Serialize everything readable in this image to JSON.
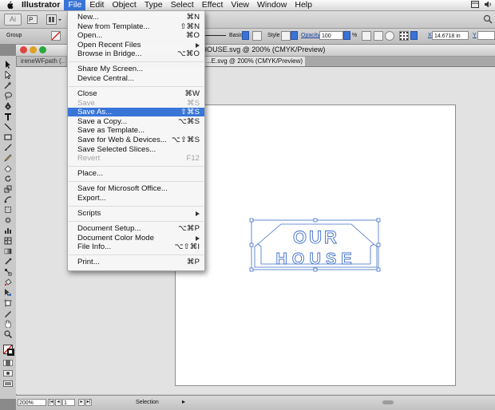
{
  "menubar": {
    "items": [
      {
        "label": "Illustrator"
      },
      {
        "label": "File"
      },
      {
        "label": "Edit"
      },
      {
        "label": "Object"
      },
      {
        "label": "Type"
      },
      {
        "label": "Select"
      },
      {
        "label": "Effect"
      },
      {
        "label": "View"
      },
      {
        "label": "Window"
      },
      {
        "label": "Help"
      }
    ],
    "active_index": 1,
    "highlight_color": "#3875d7"
  },
  "control_bar": {
    "selection_type": "Group",
    "stroke_style": "Basic",
    "style_label": "Style",
    "opacity_label": "Opacity",
    "opacity_value": "100",
    "opacity_unit": "%",
    "x_label": "X",
    "x_value": "14.6718 in",
    "y_label": "Y"
  },
  "document": {
    "window_title": "OURHOUSE.svg @ 200% (CMYK/Preview)",
    "tabs": [
      {
        "label": "ireneWFpath (..."
      },
      {
        "label": "...E.svg @ 200% (CMYK/Preview)"
      }
    ],
    "artwork": {
      "word1": "OUR",
      "word2": "HOUSE"
    }
  },
  "status_bar": {
    "zoom": "200%",
    "page": "1",
    "mode": "Selection"
  },
  "file_menu": {
    "items": [
      {
        "label": "New...",
        "shortcut": "⌘N"
      },
      {
        "label": "New from Template...",
        "shortcut": "⇧⌘N"
      },
      {
        "label": "Open...",
        "shortcut": "⌘O"
      },
      {
        "label": "Open Recent Files",
        "shortcut": ""
      },
      {
        "label": "Browse in Bridge...",
        "shortcut": "⌥⌘O"
      },
      {
        "label": "Share My Screen...",
        "shortcut": ""
      },
      {
        "label": "Device Central...",
        "shortcut": ""
      },
      {
        "label": "Close",
        "shortcut": "⌘W"
      },
      {
        "label": "Save",
        "shortcut": "⌘S"
      },
      {
        "label": "Save As...",
        "shortcut": "⇧⌘S"
      },
      {
        "label": "Save a Copy...",
        "shortcut": "⌥⌘S"
      },
      {
        "label": "Save as Template...",
        "shortcut": ""
      },
      {
        "label": "Save for Web & Devices...",
        "shortcut": "⌥⇧⌘S"
      },
      {
        "label": "Save Selected Slices...",
        "shortcut": ""
      },
      {
        "label": "Revert",
        "shortcut": "F12"
      },
      {
        "label": "Place...",
        "shortcut": ""
      },
      {
        "label": "Save for Microsoft Office...",
        "shortcut": ""
      },
      {
        "label": "Export...",
        "shortcut": ""
      },
      {
        "label": "Scripts",
        "shortcut": ""
      },
      {
        "label": "Document Setup...",
        "shortcut": "⌥⌘P"
      },
      {
        "label": "Document Color Mode",
        "shortcut": ""
      },
      {
        "label": "File Info...",
        "shortcut": "⌥⇧⌘I"
      },
      {
        "label": "Print...",
        "shortcut": "⌘P"
      }
    ],
    "disabled": [
      "Save",
      "Revert"
    ],
    "highlighted": "Save As...",
    "submenus": [
      "Open Recent Files",
      "Scripts",
      "Document Color Mode"
    ]
  },
  "colors": {
    "artwork_stroke": "#3f6fc9",
    "menu_highlight": "#3875d7"
  }
}
